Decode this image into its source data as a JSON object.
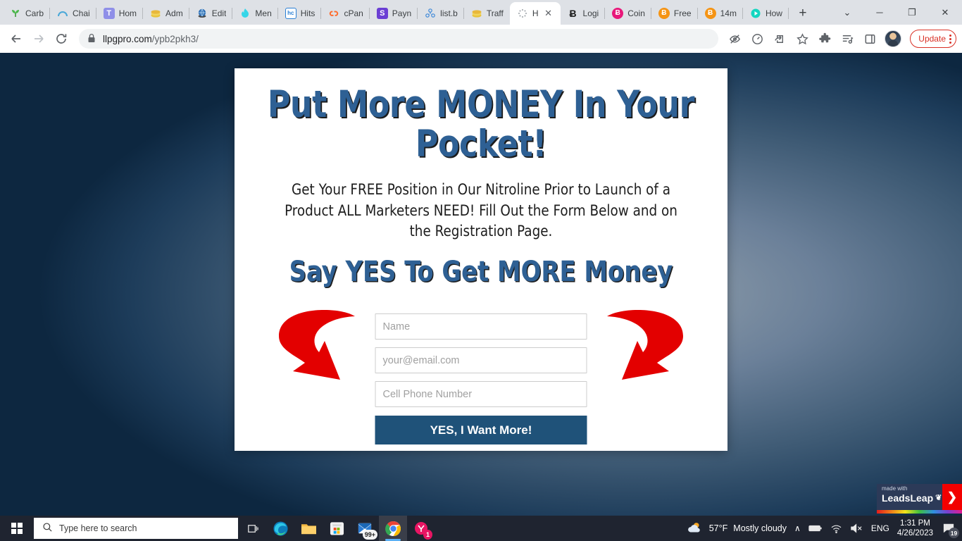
{
  "browser": {
    "tabs": [
      {
        "title": "Carb",
        "icon": "sprout-icon",
        "active": false
      },
      {
        "title": "Chai",
        "icon": "arc-icon",
        "active": false
      },
      {
        "title": "Hom",
        "icon": "letter-t-icon",
        "active": false
      },
      {
        "title": "Adm",
        "icon": "coins-icon",
        "active": false
      },
      {
        "title": "Edit",
        "icon": "globe-icon",
        "active": false
      },
      {
        "title": "Men",
        "icon": "flame-icon",
        "active": false
      },
      {
        "title": "Hits",
        "icon": "hc-icon",
        "active": false
      },
      {
        "title": "cPan",
        "icon": "cpanel-icon",
        "active": false
      },
      {
        "title": "Payn",
        "icon": "letter-s-icon",
        "active": false
      },
      {
        "title": "list.b",
        "icon": "share-node-icon",
        "active": false
      },
      {
        "title": "Traff",
        "icon": "coins-icon",
        "active": false
      },
      {
        "title": "H",
        "icon": "loading-icon",
        "active": true
      },
      {
        "title": "Logi",
        "icon": "bitcoin-b-icon",
        "active": false
      },
      {
        "title": "Coin",
        "icon": "bitcoin-pink-icon",
        "active": false
      },
      {
        "title": "Free",
        "icon": "bitcoin-orange-icon",
        "active": false
      },
      {
        "title": "14m",
        "icon": "bitcoin-orange-icon",
        "active": false
      },
      {
        "title": "How",
        "icon": "play-icon",
        "active": false
      }
    ],
    "new_tab_label": "+",
    "close_tab_label": "✕",
    "window_controls": {
      "minimize": "─",
      "maximize": "❐",
      "close": "✕",
      "tab_search": "⌄"
    },
    "toolbar": {
      "back": "←",
      "forward": "→",
      "reload": "⟳",
      "lock_icon": "🔒",
      "url_domain": "llpgpro.com",
      "url_path": "/ypb2pkh3/",
      "icons": [
        "eye-off-icon",
        "dashboard-icon",
        "share-icon",
        "star-icon",
        "extensions-icon",
        "reading-list-icon",
        "side-panel-icon"
      ],
      "update_label": "Update",
      "profile": "avatar"
    }
  },
  "page": {
    "headline": "Put More MONEY In Your Pocket!",
    "subheadline": "Get Your FREE Position in Our Nitroline Prior to Launch of a Product ALL Marketers NEED! Fill Out the Form Below and on the Registration Page.",
    "headline2": "Say YES To Get MORE Money",
    "form": {
      "name_placeholder": "Name",
      "email_placeholder": "your@email.com",
      "phone_placeholder": "Cell Phone Number",
      "submit_label": "YES, I Want More!"
    },
    "badge": {
      "made_with": "made with",
      "brand": "LeadsLeap",
      "arrow": "❯"
    },
    "colors": {
      "headline": "#2e6094",
      "button": "#1f5279",
      "arrow": "#e30000",
      "badge_bg": "#2c3a58",
      "badge_arrow_bg": "#f20000"
    }
  },
  "taskbar": {
    "search_placeholder": "Type here to search",
    "apps": [
      {
        "name": "task-view",
        "badge": ""
      },
      {
        "name": "edge",
        "badge": ""
      },
      {
        "name": "file-explorer",
        "badge": ""
      },
      {
        "name": "microsoft-store",
        "badge": ""
      },
      {
        "name": "mail",
        "badge": "99+"
      },
      {
        "name": "chrome",
        "badge": ""
      },
      {
        "name": "pink-app",
        "badge": "1"
      }
    ],
    "tray": {
      "temperature": "57°F",
      "condition": "Mostly cloudy",
      "chevron": "∧",
      "language": "ENG",
      "time": "1:31 PM",
      "date": "4/26/2023",
      "notification_count": "19"
    }
  }
}
